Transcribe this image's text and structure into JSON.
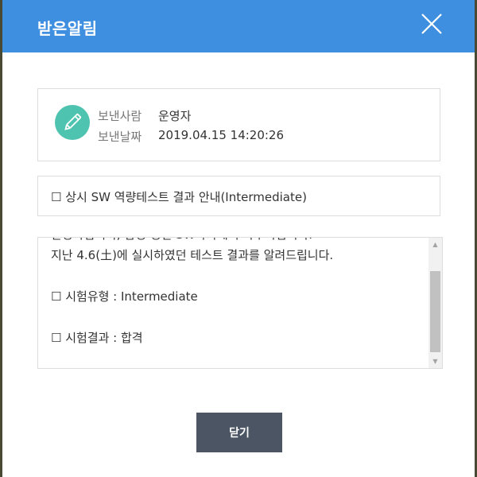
{
  "dialog": {
    "title": "받은알림",
    "close_icon": "close-x-icon",
    "header_color": "#3f8fe0"
  },
  "sender": {
    "avatar_icon": "pencil-icon",
    "avatar_color": "#4ec3b0",
    "from_label": "보낸사람",
    "from_value": "운영자",
    "date_label": "보낸날짜",
    "date_value": "2019.04.15 14:20:26"
  },
  "subject": "☐ 상시 SW 역량테스트 결과 안내(Intermediate)",
  "message": {
    "lines": [
      "안녕하십니까, 삼성 청년 SW아카데미 사무국입니다.",
      "지난 4.6(土)에 실시하였던 테스트 결과를 알려드립니다.",
      "",
      "☐ 시험유형 : Intermediate",
      "",
      "☐ 시험결과 : 합격"
    ]
  },
  "footer": {
    "confirm_label": "닫기",
    "button_color": "#4b5563"
  }
}
